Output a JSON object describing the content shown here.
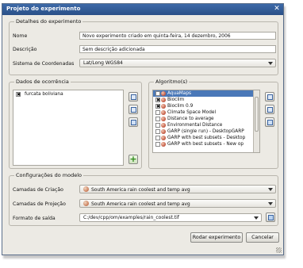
{
  "window": {
    "title": "Projeto do experimento",
    "close_label": "✕"
  },
  "details": {
    "title": "Detalhes do experimento",
    "name_label": "Nome",
    "name_value": "Novo experimento criado em quinta-feira, 14 dezembro, 2006",
    "desc_label": "Descrição",
    "desc_value": "Sem descrição adicionada",
    "coord_label": "Sistema de Coordenadas",
    "coord_value": "Lat/Long WGS84"
  },
  "occurrence": {
    "title": "Dados de ocorrência",
    "items": [
      {
        "label": "furcata boliviana",
        "checked": "✖"
      }
    ],
    "add_label": "+"
  },
  "algorithms": {
    "title": "Algoritmo(s)",
    "items": [
      {
        "label": "AquaMaps",
        "checked": "",
        "selected": true
      },
      {
        "label": "Bioclim",
        "checked": "✖",
        "selected": false
      },
      {
        "label": "Bioclim 0.9",
        "checked": "✖",
        "selected": false
      },
      {
        "label": "Climate Space Model",
        "checked": "",
        "selected": false
      },
      {
        "label": "Distance to average",
        "checked": "",
        "selected": false
      },
      {
        "label": "Environmental Distance",
        "checked": "",
        "selected": false
      },
      {
        "label": "GARP (single run) - DesktopGARP",
        "checked": "",
        "selected": false
      },
      {
        "label": "GARP with best subsets - Desktop",
        "checked": "",
        "selected": false
      },
      {
        "label": "GARP with best subsets - New op",
        "checked": "",
        "selected": false
      }
    ]
  },
  "model": {
    "title": "Configurações do modelo",
    "creation_label": "Camadas de Criação",
    "creation_value": "South America rain coolest and temp avg",
    "projection_label": "Camadas de Projeção",
    "projection_value": "South America rain coolest and temp avg",
    "format_label": "Formato de saída",
    "format_value": "C:/dev/cpp/om/examples/rain_coolest.tif"
  },
  "buttons": {
    "run": "Rodar experimento",
    "cancel": "Cancelar"
  }
}
